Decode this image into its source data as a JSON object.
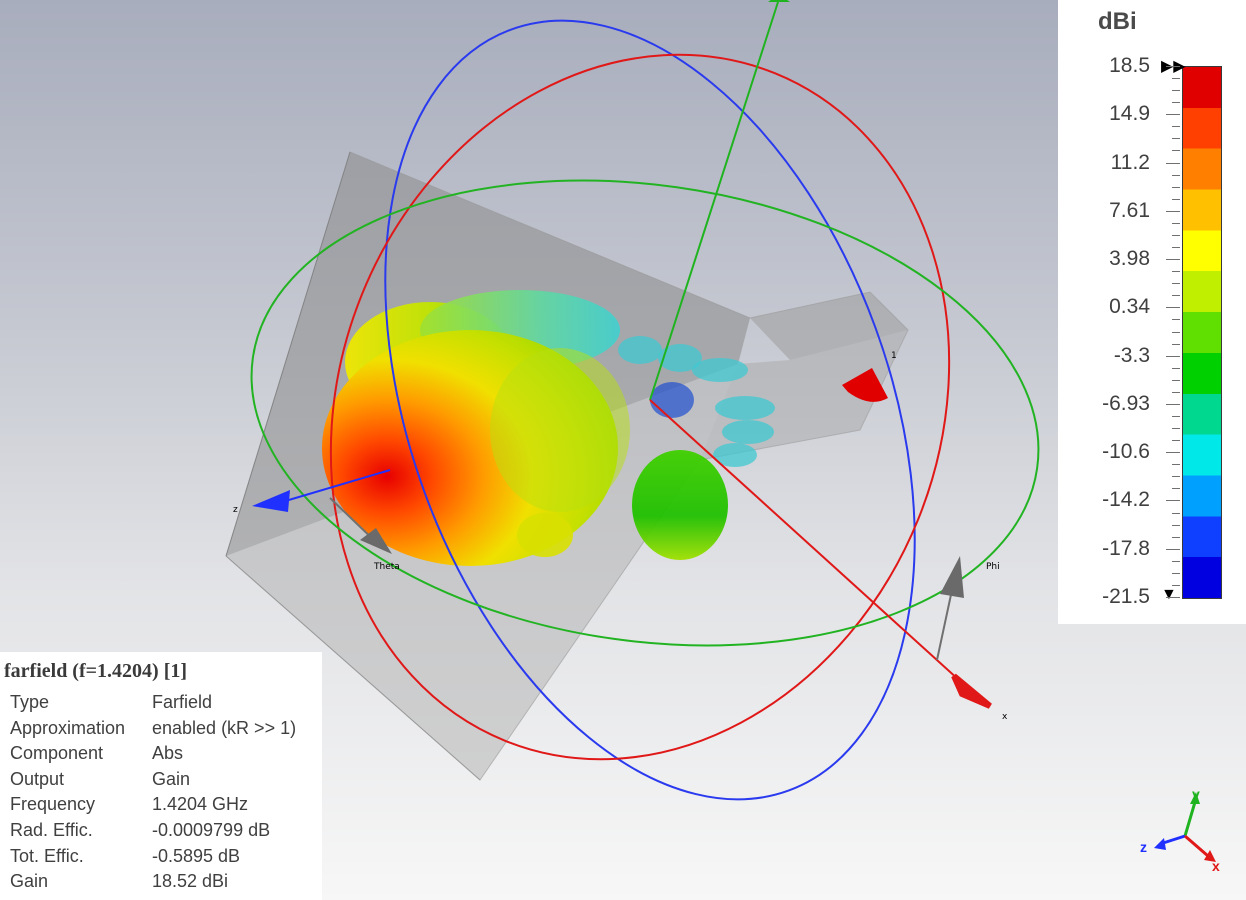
{
  "scene": {
    "axis_labels": {
      "z": "z",
      "x": "x",
      "theta": "Theta",
      "phi": "Phi",
      "port": "1"
    }
  },
  "colorbar": {
    "unit": "dBi",
    "ticks": [
      "18.5",
      "14.9",
      "11.2",
      "7.61",
      "3.98",
      "0.34",
      "-3.3",
      "-6.93",
      "-10.6",
      "-14.2",
      "-17.8",
      "-21.5"
    ],
    "range": [
      -21.5,
      18.5
    ],
    "colors": [
      "#e00000",
      "#ff4000",
      "#ff8000",
      "#ffc000",
      "#ffff00",
      "#c0f000",
      "#60e000",
      "#00d000",
      "#00d890",
      "#00e8e8",
      "#00a0ff",
      "#1040ff",
      "#0000e0"
    ]
  },
  "info": {
    "title": "farfield (f=1.4204) [1]",
    "rows": [
      {
        "key": "Type",
        "value": "Farfield"
      },
      {
        "key": "Approximation",
        "value": "enabled (kR >> 1)"
      },
      {
        "key": "Component",
        "value": "Abs"
      },
      {
        "key": "Output",
        "value": "Gain"
      },
      {
        "key": "Frequency",
        "value": "1.4204 GHz"
      },
      {
        "key": "Rad. Effic.",
        "value": "-0.0009799 dB"
      },
      {
        "key": "Tot. Effic.",
        "value": "-0.5895 dB"
      },
      {
        "key": "Gain",
        "value": "18.52 dBi"
      }
    ]
  },
  "mini_axes": {
    "y": "y",
    "z": "z",
    "x": "x"
  },
  "colors": {
    "x_axis": "#e00000",
    "y_axis": "#1fb31f",
    "z_axis": "#2030ff",
    "phi_theta_arrow": "#707070"
  }
}
